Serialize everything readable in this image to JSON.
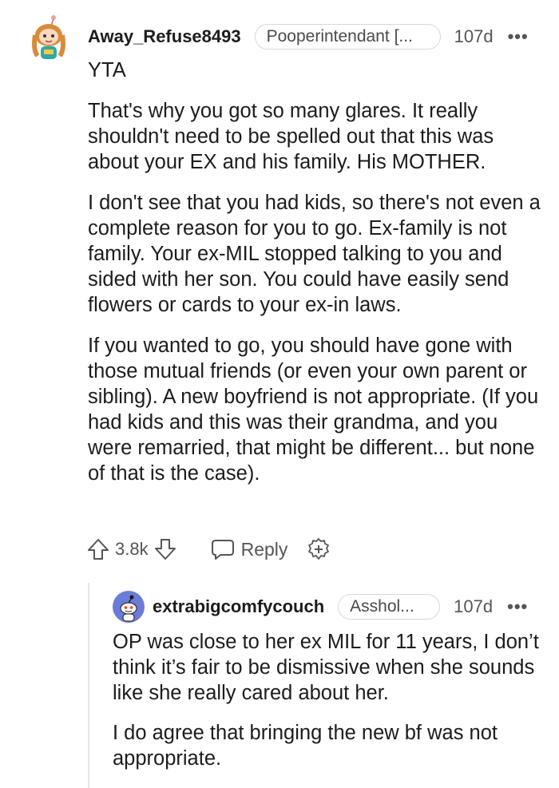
{
  "comment": {
    "username": "Away_Refuse8493",
    "flair": "Pooperintendant [...",
    "age": "107d",
    "more": "•••",
    "avatar_icon": "snoo-avatar-girl",
    "paragraphs": [
      "YTA",
      "That's why you got so many glares. It really shouldn't need to be spelled out that this was about your EX and his family. His MOTHER.",
      "I don't see that you had kids, so there's not even a complete reason for you to go. Ex-family is not family. Your ex-MIL stopped talking to you and sided with her son. You could have easily send flowers or cards to your ex-in laws.",
      "If you wanted to go, you should have gone with those mutual friends (or even your own parent or sibling). A new boyfriend is not appropriate. (If you had kids and this was their grandma, and you were remarried, that might be different... but none of that is the case)."
    ],
    "actions": {
      "score": "3.8k",
      "reply_label": "Reply",
      "upvote_icon": "arrow-up-icon",
      "downvote_icon": "arrow-down-icon",
      "reply_icon": "chat-bubble-icon",
      "award_icon": "award-plus-icon"
    }
  },
  "reply": {
    "username": "extrabigcomfycouch",
    "flair": "Asshol...",
    "age": "107d",
    "more": "•••",
    "avatar_icon": "snoo-avatar-default",
    "paragraphs": [
      "OP was close to her ex MIL for 11 years, I don’t think it’s fair to be dismissive when she sounds like she really cared about her.",
      "I do agree that bringing the new bf was not appropriate."
    ]
  },
  "colors": {
    "text": "#1a1a1b",
    "meta": "#555555",
    "thread_line": "#e6e6e6",
    "reply_avatar_bg": "#6b7bd6"
  }
}
